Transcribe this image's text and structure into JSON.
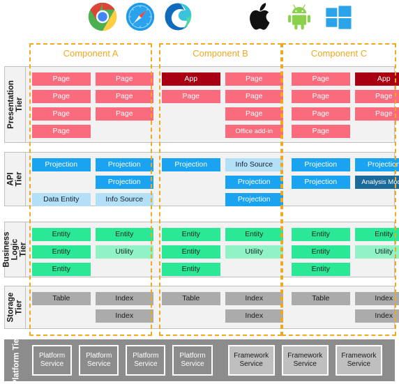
{
  "top_icons": {
    "browsers": [
      {
        "name": "chrome-icon",
        "label": "Chrome"
      },
      {
        "name": "safari-icon",
        "label": "Safari"
      },
      {
        "name": "edge-icon",
        "label": "Microsoft Edge"
      }
    ],
    "platforms": [
      {
        "name": "apple-icon",
        "label": "Apple"
      },
      {
        "name": "android-icon",
        "label": "Android"
      },
      {
        "name": "windows-icon",
        "label": "Windows"
      }
    ]
  },
  "colors": {
    "component_border": "#F1A81E",
    "component_title": "#F1A81E",
    "tier_background": "#F2F2F2",
    "tier_border": "#BFBFBF",
    "page": "#FB6B7E",
    "app": "#A80012",
    "projection": "#19A3F0",
    "info_source": "#B3E0F7",
    "analysis_model": "#1B6A9C",
    "entity": "#2BE896",
    "utility": "#8FF3C6",
    "storage": "#ABABAB",
    "platform_tier": "#8C8C8C",
    "framework_service": "#BFBFBF"
  },
  "components": [
    {
      "id": "a",
      "title": "Component A"
    },
    {
      "id": "b",
      "title": "Component B"
    },
    {
      "id": "c",
      "title": "Component C"
    }
  ],
  "tiers": [
    {
      "id": "presentation",
      "label": "Presentation Tier",
      "components": [
        {
          "id": "a",
          "left_col": [
            "Page",
            "Page",
            "Page",
            "Page"
          ],
          "right_col": [
            "Page",
            "Page",
            "Page"
          ]
        },
        {
          "id": "b",
          "left_col": [
            "App",
            "Page"
          ],
          "right_col": [
            "Page",
            "Page",
            "Page",
            "Office add-in"
          ]
        },
        {
          "id": "c",
          "left_col": [
            "Page",
            "Page",
            "Page",
            "Page"
          ],
          "right_col": [
            "App",
            "Page",
            "Page"
          ]
        }
      ]
    },
    {
      "id": "api",
      "label": "API Tier",
      "components": [
        {
          "id": "a",
          "left_col": [
            "Projection",
            "",
            "Data Entity"
          ],
          "right_col": [
            "Projection",
            "Projection",
            "Info Source"
          ]
        },
        {
          "id": "b",
          "left_col": [
            "Projection"
          ],
          "right_col": [
            "Info Source",
            "Projection",
            "Projection"
          ]
        },
        {
          "id": "c",
          "left_col": [
            "Projection",
            "Projection"
          ],
          "right_col": [
            "Projection",
            "Analysis Model"
          ]
        }
      ]
    },
    {
      "id": "business-logic",
      "label": "Business\nLogic Tier",
      "components": [
        {
          "id": "a",
          "left_col": [
            "Entity",
            "Entity",
            "Entity"
          ],
          "right_col": [
            "Entity",
            "Utility"
          ]
        },
        {
          "id": "b",
          "left_col": [
            "Entity",
            "Entity",
            "Entity"
          ],
          "right_col": [
            "Entity",
            "Utility"
          ]
        },
        {
          "id": "c",
          "left_col": [
            "Entity",
            "Entity",
            "Entity"
          ],
          "right_col": [
            "Entity",
            "Utility"
          ]
        }
      ]
    },
    {
      "id": "storage",
      "label": "Storage\nTier",
      "components": [
        {
          "id": "a",
          "left_col": [
            "Table"
          ],
          "right_col": [
            "Index",
            "Index"
          ]
        },
        {
          "id": "b",
          "left_col": [
            "Table"
          ],
          "right_col": [
            "Index",
            "Index"
          ]
        },
        {
          "id": "c",
          "left_col": [
            "Table"
          ],
          "right_col": [
            "Index",
            "Index"
          ]
        }
      ]
    }
  ],
  "platform_tier": {
    "label": "Platform\nTier",
    "services": [
      {
        "label": "Platform\nService",
        "kind": "platform"
      },
      {
        "label": "Platform\nService",
        "kind": "platform"
      },
      {
        "label": "Platform\nService",
        "kind": "platform"
      },
      {
        "label": "Platform\nService",
        "kind": "platform"
      },
      {
        "label": "Framework\nService",
        "kind": "framework"
      },
      {
        "label": "Framework\nService",
        "kind": "framework"
      },
      {
        "label": "Framework\nService",
        "kind": "framework"
      }
    ]
  }
}
